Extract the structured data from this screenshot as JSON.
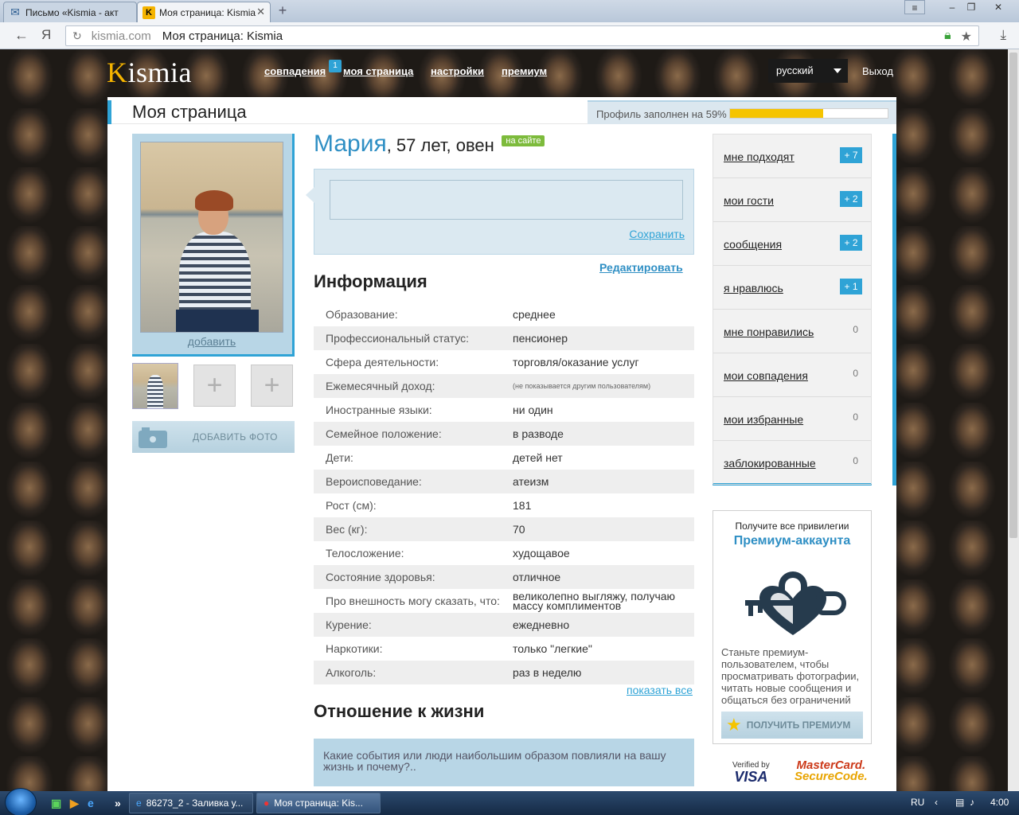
{
  "browser": {
    "tabs": [
      {
        "title": "Письмо «Kismia - акт",
        "icon": "mail-icon"
      },
      {
        "title": "Моя страница: Kismia",
        "icon": "kismia-favicon"
      }
    ],
    "close_symbol": "✕",
    "address": {
      "domain": "kismia.com",
      "page_title": "Моя страница: Kismia"
    },
    "yandex_button": "Я"
  },
  "site": {
    "logo": {
      "first": "K",
      "rest": "ismia"
    },
    "nav": [
      {
        "label": "совпадения",
        "badge": "1"
      },
      {
        "label": "моя страница"
      },
      {
        "label": "настройки"
      },
      {
        "label": "премиум"
      }
    ],
    "language": "русский",
    "logout": "Выход"
  },
  "page": {
    "title": "Моя страница",
    "profile_fill": {
      "text": "Профиль заполнен на 59%",
      "percent": 59
    }
  },
  "profile": {
    "name": "Мария",
    "age_sign": ", 57 лет, овен",
    "online_badge": "на сайте",
    "add_photo_link": "добавить",
    "add_photo_button": "ДОБАВИТЬ ФОТО",
    "status_save": "Сохранить",
    "edit_link": "Редактировать"
  },
  "info": {
    "title": "Информация",
    "rows": [
      {
        "label": "Образование:",
        "value": "среднее"
      },
      {
        "label": "Профессиональный статус:",
        "value": "пенсионер"
      },
      {
        "label": "Сфера деятельности:",
        "value": "торговля/оказание услуг"
      },
      {
        "label": "Ежемесячный доход:",
        "value": "(не показывается другим пользователям)"
      },
      {
        "label": "Иностранные языки:",
        "value": "ни один"
      },
      {
        "label": "Семейное положение:",
        "value": "в разводе"
      },
      {
        "label": "Дети:",
        "value": "детей нет"
      },
      {
        "label": "Вероисповедание:",
        "value": "атеизм"
      },
      {
        "label": "Рост (см):",
        "value": "181"
      },
      {
        "label": "Вес (кг):",
        "value": "70"
      },
      {
        "label": "Телосложение:",
        "value": "худощавое"
      },
      {
        "label": "Состояние здоровья:",
        "value": "отличное"
      },
      {
        "label": "Про внешность могу сказать, что:",
        "value": "великолепно выгляжу, получаю массу комплиментов"
      },
      {
        "label": "Курение:",
        "value": "ежедневно"
      },
      {
        "label": "Наркотики:",
        "value": "только \"легкие\""
      },
      {
        "label": "Алкоголь:",
        "value": "раз в неделю"
      }
    ],
    "show_all": "показать все"
  },
  "life": {
    "title": "Отношение к жизни",
    "question": "Какие события или люди наибольшим образом повлияли на вашу жизнь и почему?.."
  },
  "sidebar": {
    "items": [
      {
        "label": "мне подходят",
        "count": "+ 7",
        "highlight": true
      },
      {
        "label": "мои гости",
        "count": "+ 2",
        "highlight": true
      },
      {
        "label": "сообщения",
        "count": "+ 2",
        "highlight": true
      },
      {
        "label": "я нравлюсь",
        "count": "+ 1",
        "highlight": true
      },
      {
        "label": "мне понравились",
        "count": "0",
        "highlight": false
      },
      {
        "label": "мои совпадения",
        "count": "0",
        "highlight": false
      },
      {
        "label": "мои избранные",
        "count": "0",
        "highlight": false
      },
      {
        "label": "заблокированные",
        "count": "0",
        "highlight": false
      }
    ]
  },
  "premium": {
    "line1": "Получите все привилегии",
    "line2": "Премиум-аккаунта",
    "text": "Станьте премиум-пользователем, чтобы просматривать фотографии, читать новые сообщения и общаться без ограничений",
    "button": "ПОЛУЧИТЬ ПРЕМИУМ",
    "verified_line1": "Verified by",
    "verified_line2": "VISA",
    "mastercard_line1": "MasterCard.",
    "mastercard_line2": "SecureCode."
  },
  "taskbar": {
    "items": [
      {
        "label": "86273_2 - Заливка у..."
      },
      {
        "label": "Моя страница: Kis..."
      }
    ],
    "lang": "RU",
    "time": "4:00"
  },
  "colors": {
    "accent": "#2fa3d6",
    "brand_yellow": "#f5b400",
    "online_green": "#7dbb3c",
    "link_blue": "#2f8fc4"
  }
}
